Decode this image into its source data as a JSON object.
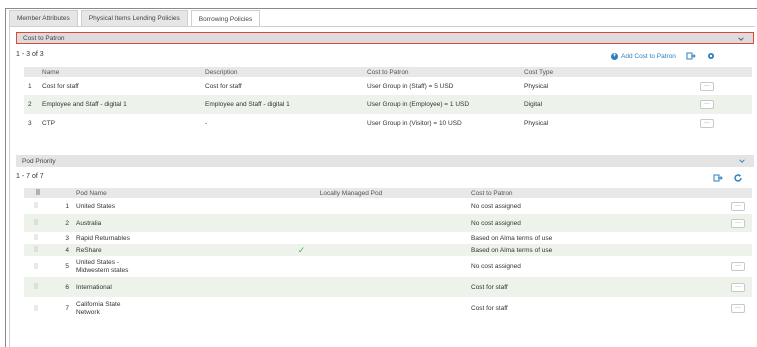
{
  "tabs": [
    {
      "label": "Member Attributes"
    },
    {
      "label": "Physical Items Lending Policies"
    },
    {
      "label": "Borrowing Policies"
    }
  ],
  "cost_to_patron": {
    "title": "Cost to Patron",
    "count": "1 - 3 of 3",
    "add_label": "Add Cost to Patron",
    "columns": [
      "Name",
      "Description",
      "Cost to Patron",
      "Cost Type"
    ],
    "rows": [
      {
        "num": "1",
        "name": "Cost for staff",
        "description": "Cost for staff",
        "cost": "User Group in (Staff) = 5 USD",
        "type": "Physical",
        "action": "···"
      },
      {
        "num": "2",
        "name": "Employee and Staff - digital 1",
        "description": "Employee and Staff - digital 1",
        "cost": "User Group in (Employee) = 1 USD",
        "type": "Digital",
        "action": "···"
      },
      {
        "num": "3",
        "name": "CTP",
        "description": "-",
        "cost": "User Group in (Visitor) = 10 USD",
        "type": "Physical",
        "action": "···"
      }
    ]
  },
  "pod_priority": {
    "title": "Pod Priority",
    "count": "1 - 7 of 7",
    "columns": [
      "Pod Name",
      "Locally Managed Pod",
      "Cost to Patron"
    ],
    "rows": [
      {
        "num": "1",
        "name": "United States",
        "local": "",
        "cost": "No cost assigned",
        "action": "···"
      },
      {
        "num": "2",
        "name": "Australia",
        "local": "",
        "cost": "No cost assigned",
        "action": "···"
      },
      {
        "num": "3",
        "name": "Rapid Returnables",
        "local": "",
        "cost": "Based on Alma terms of use",
        "action": ""
      },
      {
        "num": "4",
        "name": "ReShare",
        "local": "✓",
        "cost": "Based on Alma terms of use",
        "action": ""
      },
      {
        "num": "5",
        "name": "United States -\nMidwestern states",
        "local": "",
        "cost": "No cost assigned",
        "action": "···"
      },
      {
        "num": "6",
        "name": "International",
        "local": "",
        "cost": "Cost for staff",
        "action": "···"
      },
      {
        "num": "7",
        "name": "California State\nNetwork",
        "local": "",
        "cost": "Cost for staff",
        "action": "···"
      }
    ]
  },
  "colors": {
    "accent": "#2a7fc1",
    "highlight_border": "#e0453c",
    "row_alt": "#edf3ea",
    "check": "#4fae5c"
  },
  "icons": [
    "plus-circle-icon",
    "export-icon",
    "gear-icon",
    "chevron-down-icon",
    "refresh-icon",
    "drag-handle-icon",
    "checkmark-icon"
  ]
}
